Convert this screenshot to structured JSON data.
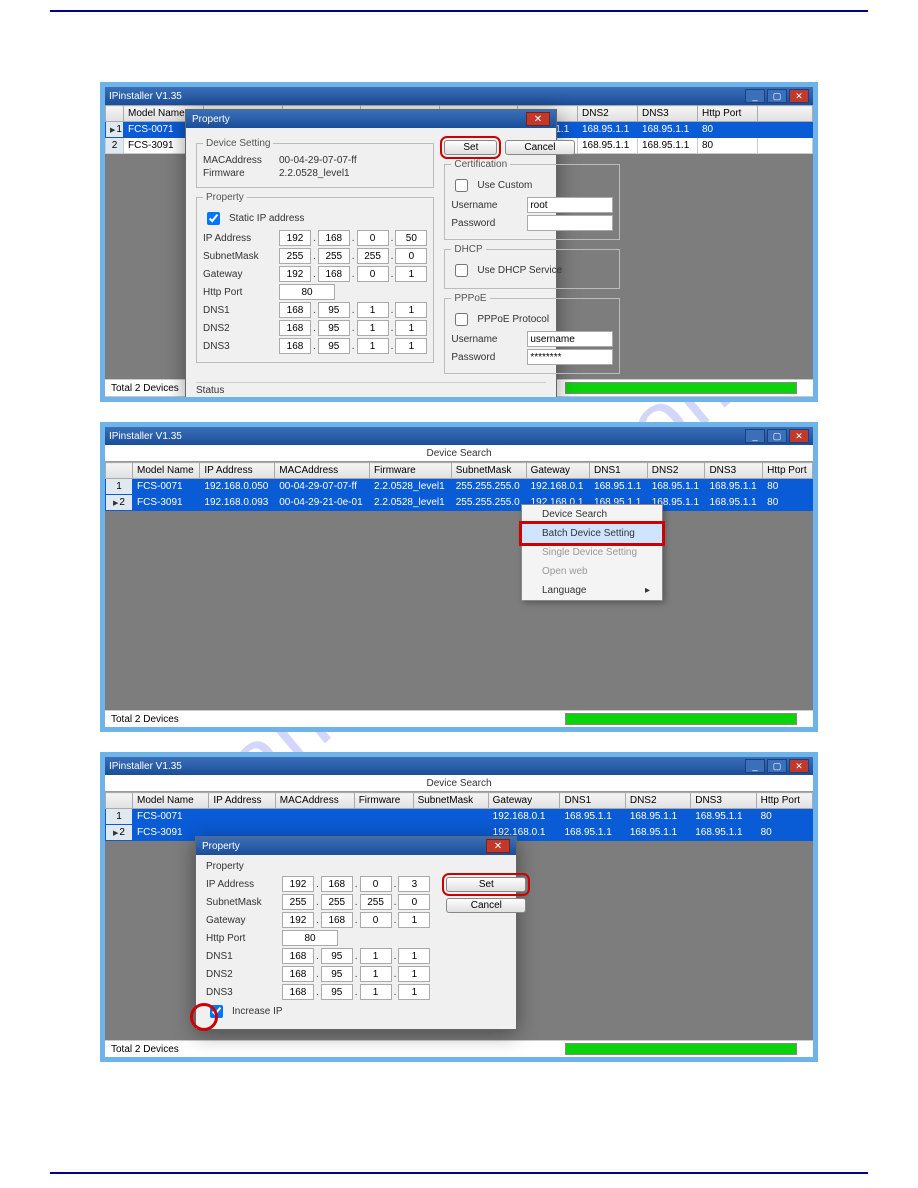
{
  "app": {
    "title": "IPinstaller V1.35",
    "device_search_tab": "Device Search",
    "status_text": "Total 2 Devices"
  },
  "columns": {
    "model": "Model Name",
    "ip": "IP Address",
    "mac": "MACAddress",
    "fw": "Firmware",
    "subnet": "SubnetMask",
    "gw": "Gateway",
    "dns1": "DNS1",
    "dns2": "DNS2",
    "dns3": "DNS3",
    "http": "Http Port"
  },
  "rows": [
    {
      "n": "1",
      "model": "FCS-0071",
      "ip": "192.168.0.050",
      "mac": "00-04-29-07-07-ff",
      "fw": "2.2.0528_level1",
      "subnet": "255.255.255.0",
      "gw": "192.168.0.1",
      "dns1": "168.95.1.1",
      "dns2": "168.95.1.1",
      "dns3": "168.95.1.1",
      "http": "80"
    },
    {
      "n": "2",
      "model": "FCS-3091",
      "ip": "192.168.0.093",
      "mac": "00-04-29-21-0e-01",
      "fw": "2.2.0528_level1",
      "subnet": "255.255.255.0",
      "gw": "192.168.0.1",
      "dns1": "168.95.1.1",
      "dns2": "168.95.1.1",
      "dns3": "168.95.1.1",
      "http": "80"
    }
  ],
  "dialog1": {
    "title": "Property",
    "device_setting": "Device Setting",
    "mac_lbl": "MACAddress",
    "mac_val": "00-04-29-07-07-ff",
    "fw_lbl": "Firmware",
    "fw_val": "2.2.0528_level1",
    "property": "Property",
    "static_ip": "Static IP address",
    "ip_lbl": "IP Address",
    "ip": [
      "192",
      "168",
      "0",
      "50"
    ],
    "subnet_lbl": "SubnetMask",
    "subnet": [
      "255",
      "255",
      "255",
      "0"
    ],
    "gw_lbl": "Gateway",
    "gw": [
      "192",
      "168",
      "0",
      "1"
    ],
    "http_lbl": "Http Port",
    "http": "80",
    "dns1_lbl": "DNS1",
    "dns1": [
      "168",
      "95",
      "1",
      "1"
    ],
    "dns2_lbl": "DNS2",
    "dns2": [
      "168",
      "95",
      "1",
      "1"
    ],
    "dns3_lbl": "DNS3",
    "dns3": [
      "168",
      "95",
      "1",
      "1"
    ],
    "set": "Set",
    "cancel": "Cancel",
    "cert": "Certification",
    "use_custom": "Use Custom",
    "user_lbl": "Username",
    "user_val": "root",
    "pass_lbl": "Password",
    "dhcp": "DHCP",
    "use_dhcp": "Use DHCP Service",
    "pppoe": "PPPoE",
    "pppoe_proto": "PPPoE Protocol",
    "pppoe_user": "username",
    "pppoe_pass": "********",
    "status": "Status"
  },
  "ctx": {
    "search": "Device Search",
    "batch": "Batch Device Setting",
    "single": "Single Device Setting",
    "openweb": "Open web",
    "lang": "Language"
  },
  "dialog3": {
    "title": "Property",
    "property": "Property",
    "ip_lbl": "IP Address",
    "ip": [
      "192",
      "168",
      "0",
      "3"
    ],
    "subnet_lbl": "SubnetMask",
    "subnet": [
      "255",
      "255",
      "255",
      "0"
    ],
    "gw_lbl": "Gateway",
    "gw": [
      "192",
      "168",
      "0",
      "1"
    ],
    "http_lbl": "Http Port",
    "http": "80",
    "dns1_lbl": "DNS1",
    "dns1": [
      "168",
      "95",
      "1",
      "1"
    ],
    "dns2_lbl": "DNS2",
    "dns2": [
      "168",
      "95",
      "1",
      "1"
    ],
    "dns3_lbl": "DNS3",
    "dns3": [
      "168",
      "95",
      "1",
      "1"
    ],
    "increase": "Increase IP",
    "set": "Set",
    "cancel": "Cancel"
  },
  "watermark": "manualshive.com"
}
